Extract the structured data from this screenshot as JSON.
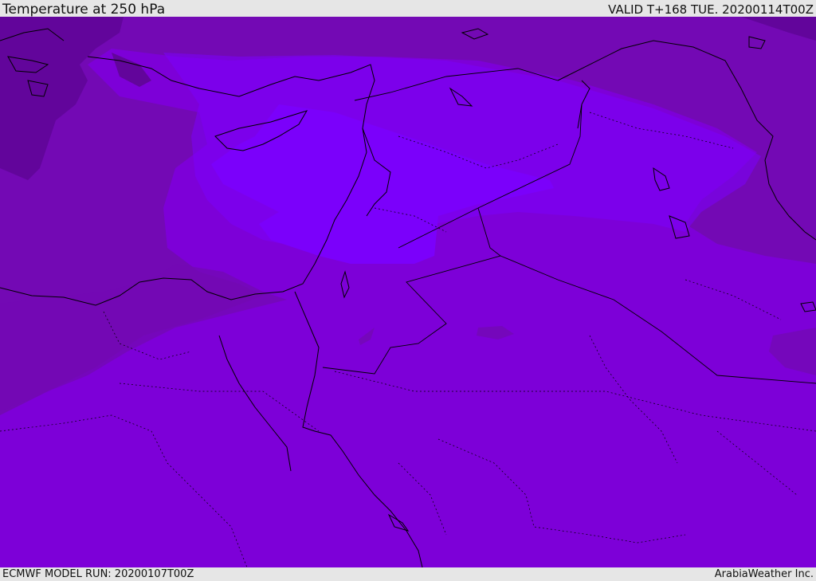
{
  "header": {
    "title": "Temperature at 250 hPa",
    "valid": "VALID T+168 TUE. 20200114T00Z"
  },
  "footer": {
    "model_run": "ECMWF MODEL RUN: 20200107T00Z",
    "credit": "ArabiaWeather Inc."
  },
  "colors": {
    "band_cold": "#62059b",
    "band_2": "#7309b4",
    "band_3": "#7d00d8",
    "band_warm": "#7b00fb",
    "border": "#000000"
  }
}
